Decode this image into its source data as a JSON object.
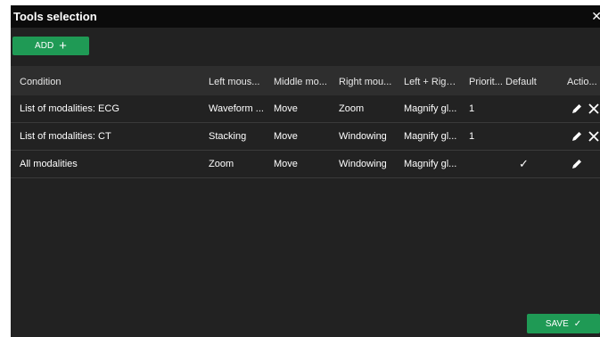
{
  "dialog": {
    "title": "Tools selection",
    "close_glyph": "✕"
  },
  "toolbar": {
    "add_label": "ADD",
    "add_icon": "+"
  },
  "table": {
    "headers": [
      "Condition",
      "Left mous...",
      "Middle mo...",
      "Right mou...",
      "Left + Righ...",
      "Priorit...",
      "Default",
      "Actio..."
    ],
    "rows": [
      {
        "condition": "List of modalities: ECG",
        "left": "Waveform ...",
        "middle": "Move",
        "right": "Zoom",
        "left_right": "Magnify gl...",
        "priority": "1",
        "default": "",
        "actions": [
          "edit",
          "delete"
        ]
      },
      {
        "condition": "List of modalities: CT",
        "left": "Stacking",
        "middle": "Move",
        "right": "Windowing",
        "left_right": "Magnify gl...",
        "priority": "1",
        "default": "",
        "actions": [
          "edit",
          "delete"
        ]
      },
      {
        "condition": "All modalities",
        "left": "Zoom",
        "middle": "Move",
        "right": "Windowing",
        "left_right": "Magnify gl...",
        "priority": "",
        "default": "✓",
        "actions": [
          "edit"
        ]
      }
    ]
  },
  "footer": {
    "save_label": "SAVE",
    "save_icon": "✓"
  },
  "colors": {
    "accent": "#1f9a55",
    "background": "#222222",
    "header": "#2e2e2e",
    "titlebar": "#0b0b0b"
  }
}
